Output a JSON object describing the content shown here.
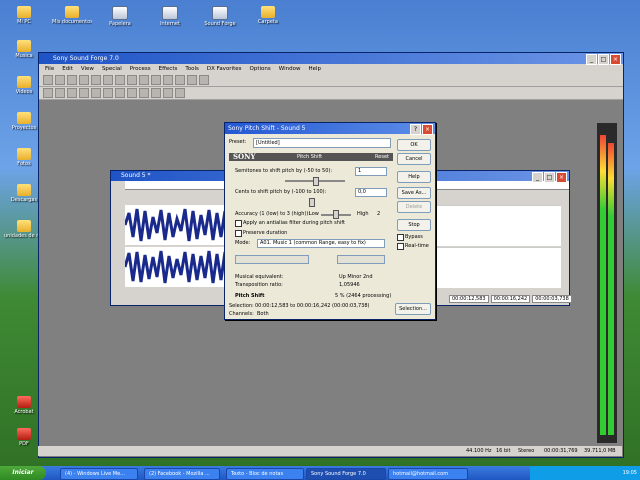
{
  "desktop": {
    "icons": [
      {
        "label": "Mi PC",
        "kind": "folder"
      },
      {
        "label": "Mis documentos",
        "kind": "folder"
      },
      {
        "label": "Papelera",
        "kind": "app"
      },
      {
        "label": "Internet",
        "kind": "app"
      },
      {
        "label": "Sound Forge",
        "kind": "app"
      },
      {
        "label": "Carpeta",
        "kind": "folder"
      },
      {
        "label": "Musica",
        "kind": "folder"
      },
      {
        "label": "Videos",
        "kind": "folder"
      },
      {
        "label": "Proyectos",
        "kind": "folder"
      },
      {
        "label": "Fotos",
        "kind": "folder"
      },
      {
        "label": "Descargas",
        "kind": "folder"
      },
      {
        "label": "unidades de maestria",
        "kind": "folder"
      },
      {
        "label": "Acrobat",
        "kind": "red"
      },
      {
        "label": "PDF",
        "kind": "red"
      }
    ]
  },
  "app": {
    "title": "Sony Sound Forge 7.0",
    "menu": [
      "File",
      "Edit",
      "View",
      "Special",
      "Process",
      "Effects",
      "Tools",
      "DX Favorites",
      "Options",
      "Window",
      "Help"
    ]
  },
  "sound": {
    "title": "Sound 5 *",
    "times": [
      "00:00:12,583",
      "00:00:16,242",
      "00:00:03,738"
    ]
  },
  "dialog": {
    "title": "Sony Pitch Shift - Sound 5",
    "preset_label": "Preset:",
    "preset_value": "[Untitled]",
    "band_brand": "SONY",
    "band_title": "Pitch Shift",
    "band_right": "Reset",
    "semitones_label": "Semitones to shift pitch by (-50 to 50):",
    "semitones_value": "1",
    "cents_label": "Cents to shift pitch by (-100 to 100):",
    "cents_value": "0,0",
    "accuracy_label": "Accuracy (1 (low) to 3 (high)):",
    "accuracy_low": "Low",
    "accuracy_high": "High",
    "accuracy_value": "2",
    "antialias_label": "Apply an antialias filter during pitch shift",
    "preserve_label": "Preserve duration",
    "mode_label": "Mode:",
    "mode_value": "A01. Music 1 (common Range, easy to fix)",
    "musical_label": "Musical equivalent:",
    "musical_value": "Up Minor 2nd",
    "ratio_label": "Transposition ratio:",
    "ratio_value": "1,05946",
    "status_label": "Pitch Shift",
    "status_value": "5 %  (2464 processing)",
    "selection_label": "Selection:",
    "selection_value": "00:00:12,583 to 00:00:16,242 (00:00:03,738)",
    "channels_label": "Channels:",
    "channels_value": "Both",
    "buttons": {
      "ok": "OK",
      "cancel": "Cancel",
      "help": "Help",
      "save_as": "Save As...",
      "delete": "Delete",
      "stop": "Stop",
      "bypass": "Bypass",
      "real_time": "Real-time",
      "selection": "Selection..."
    }
  },
  "statusbar": {
    "rate": "44.100 Hz",
    "bits": "16 bit",
    "channels": "Stereo",
    "length": "00:00:31,769",
    "disk": "39.711,0 MB"
  },
  "taskbar": {
    "start": "Iniciar",
    "tasks": [
      "(4) - Windows Live Me...",
      "(2) Facebook - Mozilla ...",
      "Texto - Bloc de notas",
      "Sony Sound Forge 7.0",
      "hotmail@hotmail.com"
    ],
    "clock": "19:05"
  }
}
